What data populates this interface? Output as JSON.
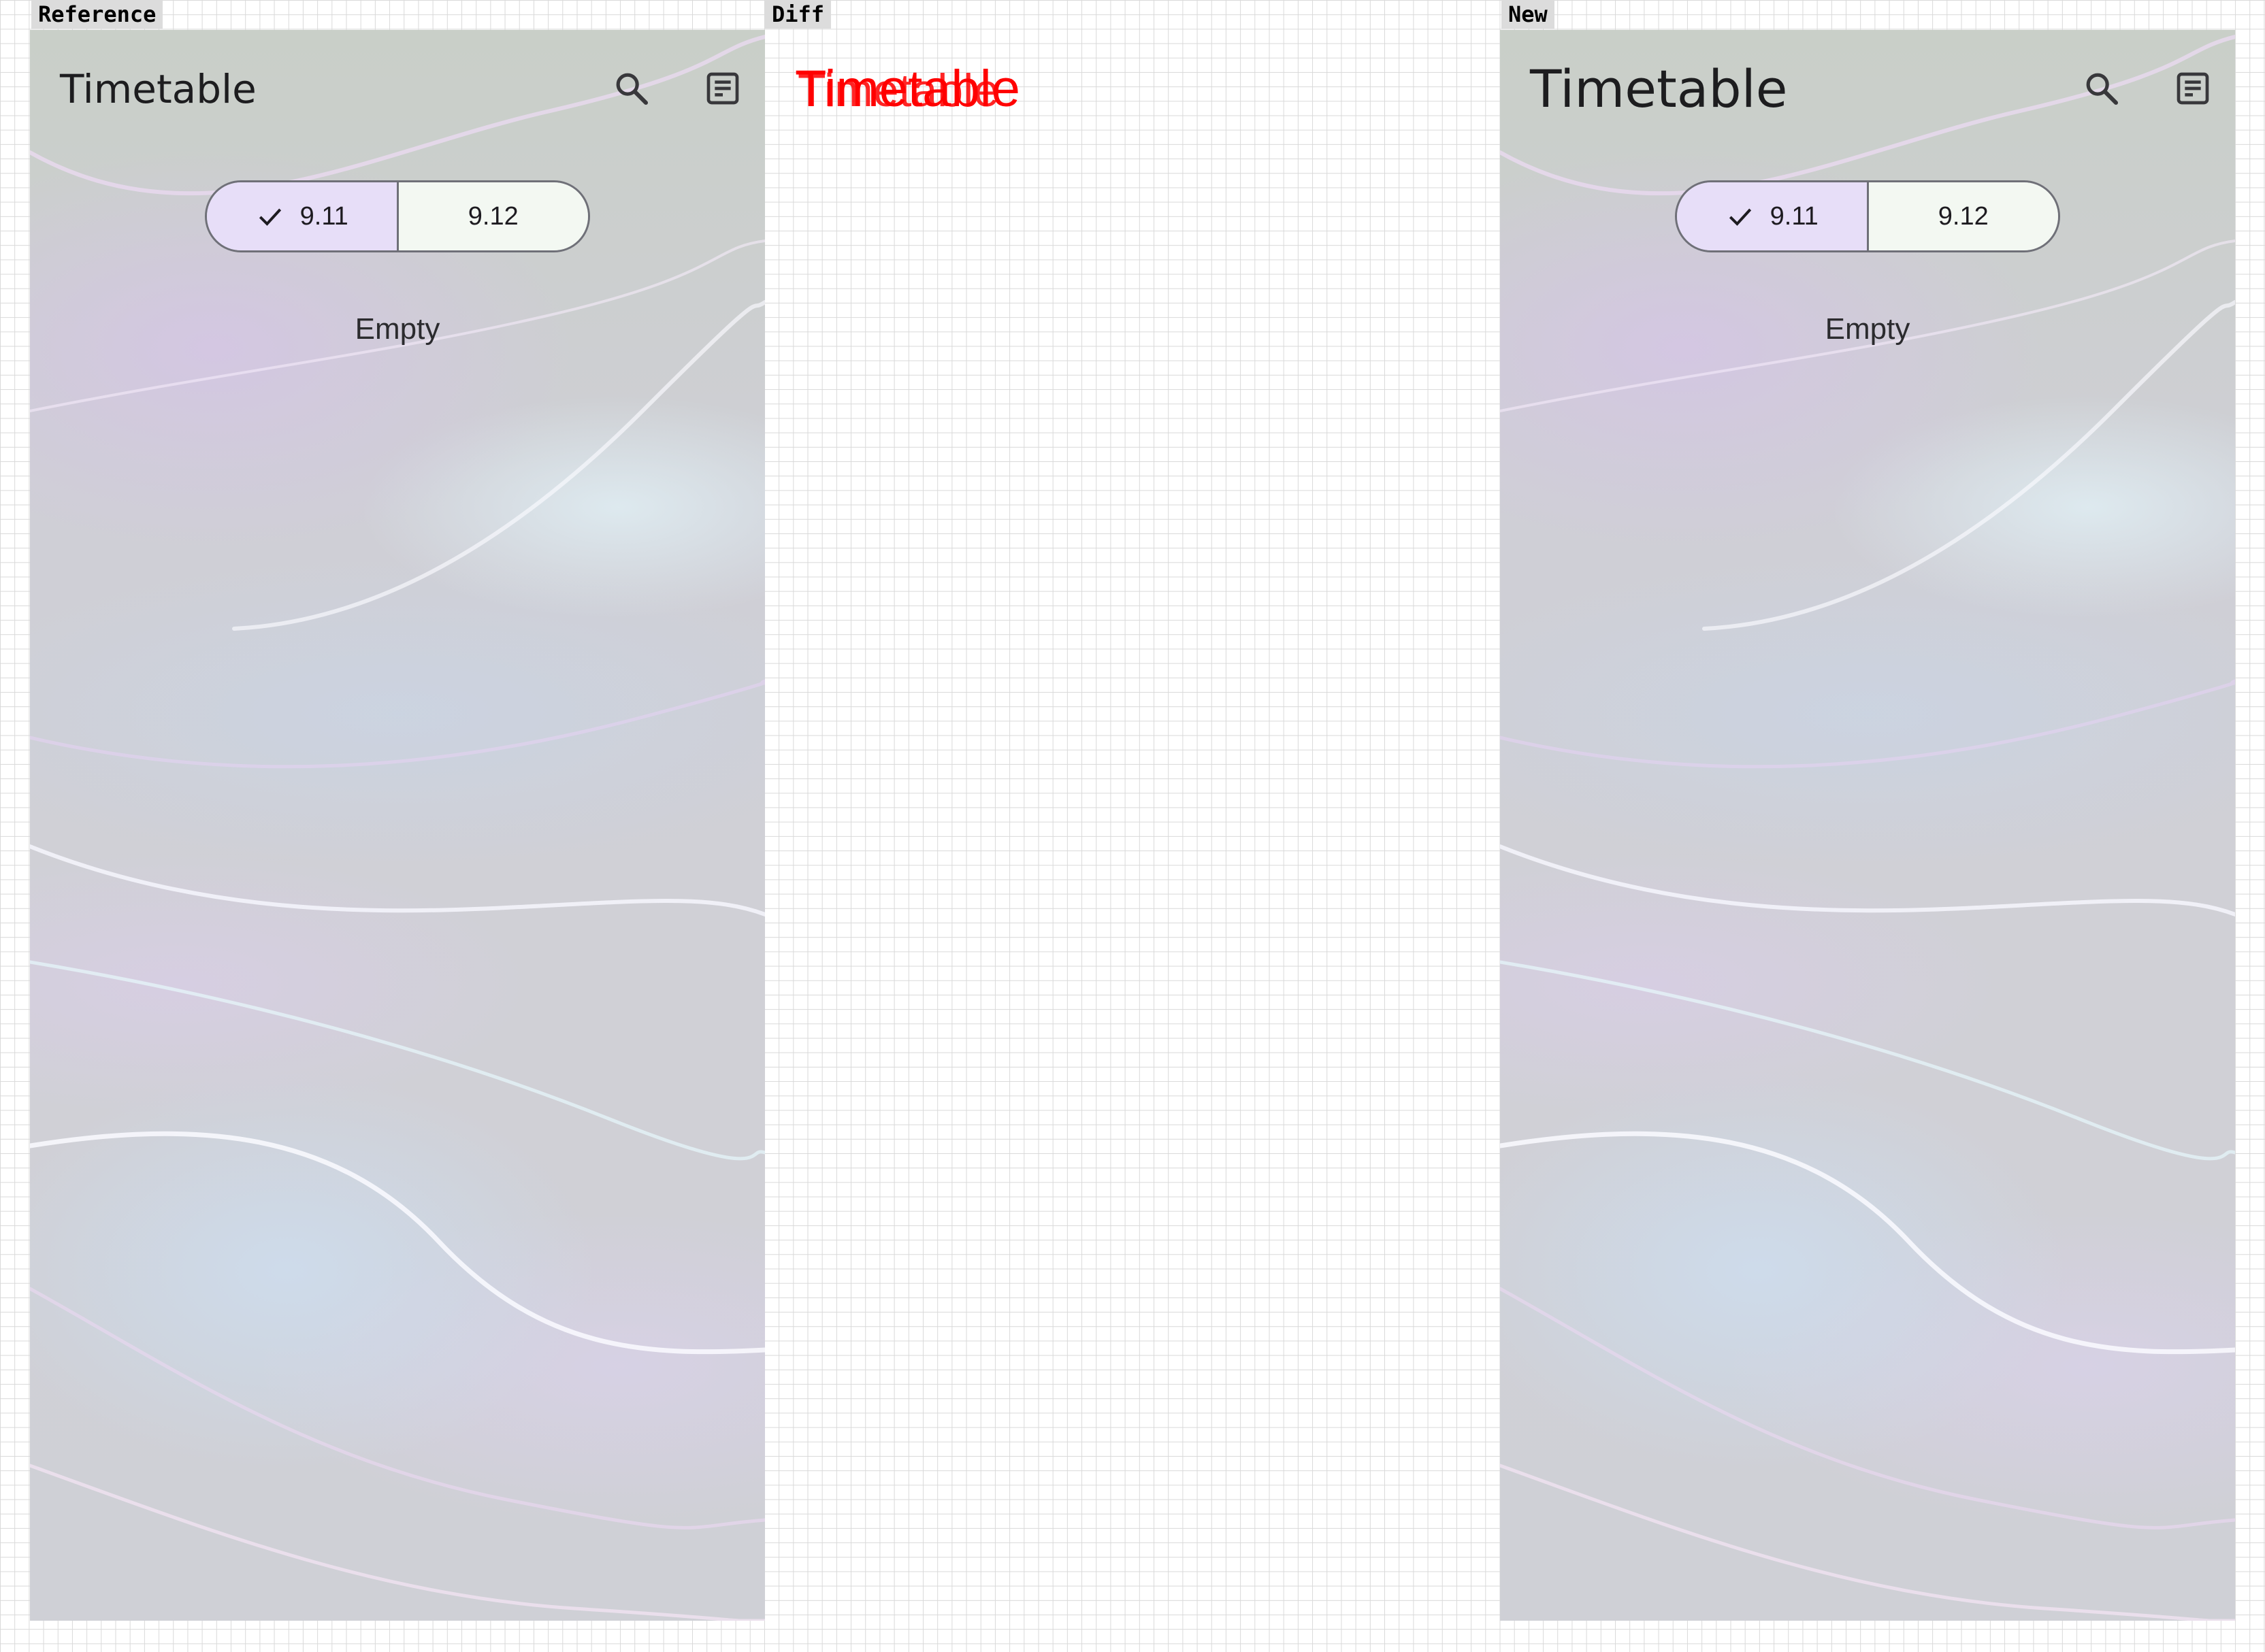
{
  "labels": {
    "reference": "Reference",
    "diff": "Diff",
    "new": "New"
  },
  "app": {
    "title": "Timetable",
    "search_icon": "search-icon",
    "menu_icon": "notes-icon",
    "segments": [
      {
        "label": "9.11",
        "selected": true
      },
      {
        "label": "9.12",
        "selected": false
      }
    ],
    "empty_text": "Empty"
  },
  "diff": {
    "title_a": "Timetable",
    "title_b": "Timetable"
  },
  "colors": {
    "selected_segment": "#e7def8",
    "unselected_segment": "#f3f8f2",
    "outline": "#6f7078",
    "diff_red": "#ff0000"
  }
}
